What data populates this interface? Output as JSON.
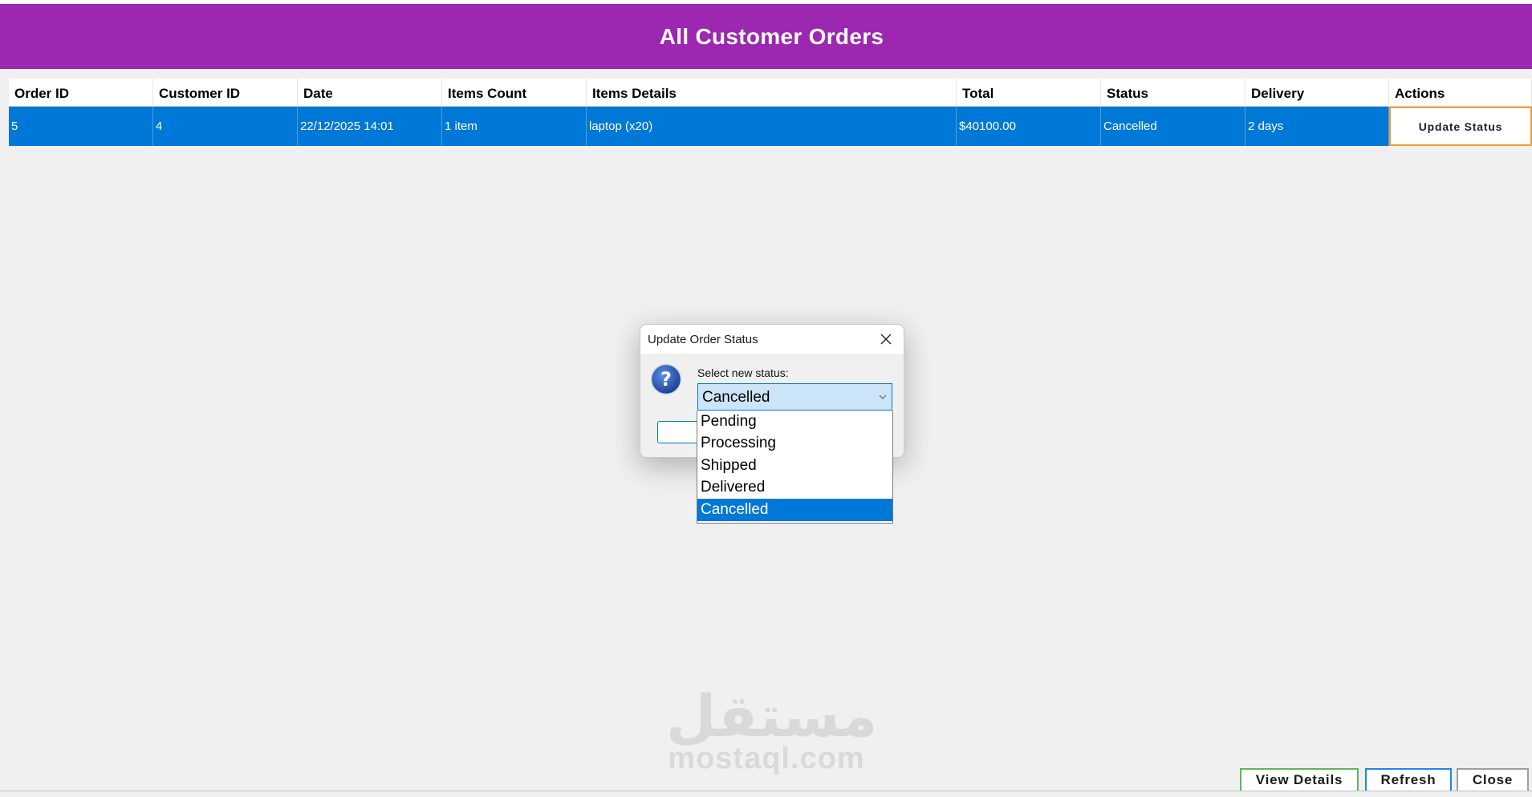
{
  "header": {
    "title": "All Customer Orders",
    "background": "#9c27b0"
  },
  "table": {
    "columns": [
      "Order ID",
      "Customer ID",
      "Date",
      "Items Count",
      "Items Details",
      "Total",
      "Status",
      "Delivery",
      "Actions"
    ],
    "rows": [
      {
        "order_id": "5",
        "customer_id": "4",
        "date": "22/12/2025 14:01",
        "items_count": "1 item",
        "items_details": "laptop (x20)",
        "total": "$40100.00",
        "status": "Cancelled",
        "delivery": "2 days",
        "action_label": "Update Status"
      }
    ],
    "selected_row_color": "#0078d7"
  },
  "dialog": {
    "title": "Update Order Status",
    "prompt": "Select new status:",
    "selected_value": "Cancelled",
    "options": [
      "Pending",
      "Processing",
      "Shipped",
      "Delivered",
      "Cancelled"
    ],
    "icon": "question-icon"
  },
  "watermark": {
    "arabic": "مستقل",
    "latin": "mostaql.com"
  },
  "buttons": {
    "view_details": "View Details",
    "refresh": "Refresh",
    "close": "Close"
  }
}
